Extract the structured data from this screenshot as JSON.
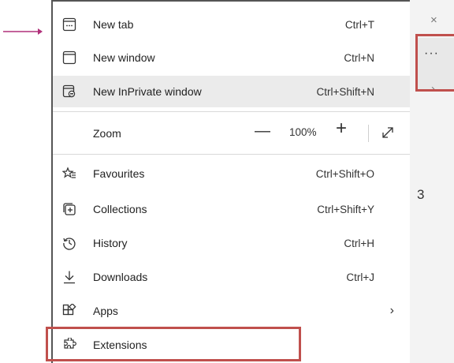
{
  "menu": {
    "items": [
      {
        "label": "New tab",
        "shortcut": "Ctrl+T",
        "icon": "new-tab-icon"
      },
      {
        "label": "New window",
        "shortcut": "Ctrl+N",
        "icon": "new-window-icon"
      },
      {
        "label": "New InPrivate window",
        "shortcut": "Ctrl+Shift+N",
        "icon": "inprivate-icon"
      },
      {
        "label": "Favourites",
        "shortcut": "Ctrl+Shift+O",
        "icon": "favourites-icon"
      },
      {
        "label": "Collections",
        "shortcut": "Ctrl+Shift+Y",
        "icon": "collections-icon"
      },
      {
        "label": "History",
        "shortcut": "Ctrl+H",
        "icon": "history-icon"
      },
      {
        "label": "Downloads",
        "shortcut": "Ctrl+J",
        "icon": "downloads-icon"
      },
      {
        "label": "Apps",
        "submenu": "›",
        "icon": "apps-icon"
      },
      {
        "label": "Extensions",
        "icon": "extensions-icon"
      }
    ],
    "zoom": {
      "label": "Zoom",
      "minus": "—",
      "value": "100%",
      "plus": "+",
      "fullscreen_icon": "fullscreen-icon"
    }
  },
  "background": {
    "close": "×",
    "more": "···",
    "chevron": "›",
    "digit": "3"
  },
  "colors": {
    "highlight": "#c0504d",
    "arrow": "#b0307a",
    "hover": "#ebebeb"
  }
}
